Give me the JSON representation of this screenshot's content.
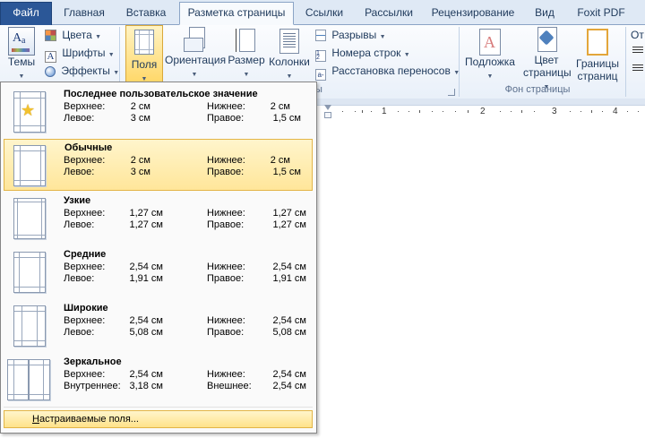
{
  "tabs": {
    "file": "Файл",
    "home": "Главная",
    "insert": "Вставка",
    "page_layout": "Разметка страницы",
    "references": "Ссылки",
    "mailings": "Рассылки",
    "review": "Рецензирование",
    "view": "Вид",
    "foxit": "Foxit PDF"
  },
  "ribbon": {
    "themes": {
      "themes_label": "Темы",
      "colors": "Цвета",
      "fonts": "Шрифты",
      "effects": "Эффекты"
    },
    "page_setup": {
      "margins": "Поля",
      "orientation": "Ориентация",
      "size": "Размер",
      "columns": "Колонки",
      "breaks": "Разрывы",
      "line_numbers": "Номера строк",
      "hyphenation": "Расстановка переносов",
      "group_label_visible": "ы"
    },
    "page_background": {
      "watermark": "Подложка",
      "page_color_1": "Цвет",
      "page_color_2": "страницы",
      "page_borders_1": "Границы",
      "page_borders_2": "страниц",
      "group_label": "Фон страницы"
    },
    "paragraph_partial": "От"
  },
  "ruler": {
    "labels": [
      "1",
      "2",
      "3",
      "4"
    ]
  },
  "margins_menu": {
    "items": [
      {
        "name": "Последнее пользовательское значение",
        "l1": "Верхнее:",
        "v1": "2 см",
        "l2": "Нижнее:",
        "v2": "2 см",
        "l3": "Левое:",
        "v3": "3 см",
        "l4": "Правое:",
        "v4": "1,5 см",
        "selected": false,
        "icon": "star"
      },
      {
        "name": "Обычные",
        "l1": "Верхнее:",
        "v1": "2 см",
        "l2": "Нижнее:",
        "v2": "2 см",
        "l3": "Левое:",
        "v3": "3 см",
        "l4": "Правое:",
        "v4": "1,5 см",
        "selected": true,
        "icon": "normal"
      },
      {
        "name": "Узкие",
        "l1": "Верхнее:",
        "v1": "1,27 см",
        "l2": "Нижнее:",
        "v2": "1,27 см",
        "l3": "Левое:",
        "v3": "1,27 см",
        "l4": "Правое:",
        "v4": "1,27 см",
        "selected": false,
        "icon": "narrow"
      },
      {
        "name": "Средние",
        "l1": "Верхнее:",
        "v1": "2,54 см",
        "l2": "Нижнее:",
        "v2": "2,54 см",
        "l3": "Левое:",
        "v3": "1,91 см",
        "l4": "Правое:",
        "v4": "1,91 см",
        "selected": false,
        "icon": "moderate"
      },
      {
        "name": "Широкие",
        "l1": "Верхнее:",
        "v1": "2,54 см",
        "l2": "Нижнее:",
        "v2": "2,54 см",
        "l3": "Левое:",
        "v3": "5,08 см",
        "l4": "Правое:",
        "v4": "5,08 см",
        "selected": false,
        "icon": "wide"
      },
      {
        "name": "Зеркальное",
        "l1": "Верхнее:",
        "v1": "2,54 см",
        "l2": "Нижнее:",
        "v2": "2,54 см",
        "l3": "Внутреннее:",
        "v3": "3,18 см",
        "l4": "Внешнее:",
        "v4": "2,54 см",
        "selected": false,
        "icon": "mirrored"
      }
    ],
    "custom_prefix": "Н",
    "custom_rest": "астраиваемые поля..."
  },
  "colors": {
    "file_tab": "#2b5797",
    "highlight": "#ffe69a",
    "ribbon_text": "#1e395b"
  }
}
